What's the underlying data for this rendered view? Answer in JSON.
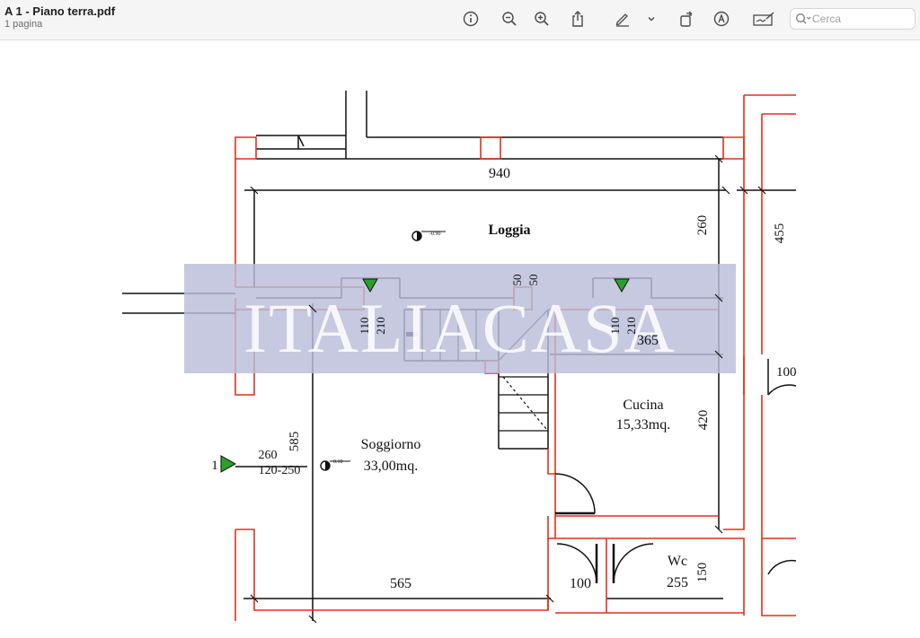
{
  "window": {
    "title": "A 1 - Piano terra.pdf",
    "subtitle": "1 pagina"
  },
  "toolbar": {
    "buttons": [
      {
        "icon": "info-icon"
      },
      {
        "icon": "zoom-out-icon"
      },
      {
        "icon": "zoom-in-icon"
      },
      {
        "icon": "share-icon"
      },
      {
        "icon": "markup-pen-icon"
      },
      {
        "icon": "chevron-down-icon"
      },
      {
        "icon": "rotate-icon"
      },
      {
        "icon": "annotate-icon"
      },
      {
        "icon": "signature-icon"
      }
    ],
    "search_placeholder": "Cerca"
  },
  "plan": {
    "watermark": "ITALIACASA",
    "rooms": {
      "loggia": "Loggia",
      "soggiorno": "Soggiorno",
      "soggiorno_area": "33,00mq.",
      "cucina": "Cucina",
      "cucina_area": "15,33mq.",
      "wc": "Wc",
      "wc_dim": "255"
    },
    "dimensions": {
      "d940": "940",
      "d260": "260",
      "d455": "455",
      "d50a": "50",
      "d50b": "50",
      "d110a": "110",
      "d210a": "210",
      "d110b": "110",
      "d210b": "210",
      "d365": "365",
      "d420": "420",
      "d585": "585",
      "d260w": "260",
      "d120": "120-250",
      "d565": "565",
      "d100": "100",
      "d150": "150",
      "d100r": "100"
    },
    "markers": {
      "entry": "1",
      "level_loggia": "-0.90",
      "level_soggiorno": "-0.10"
    }
  },
  "colors": {
    "wall_red": "#e2301a",
    "line": "#111111",
    "watermark_band": "#b9bdd9",
    "marker_green": "#2ca02c"
  }
}
